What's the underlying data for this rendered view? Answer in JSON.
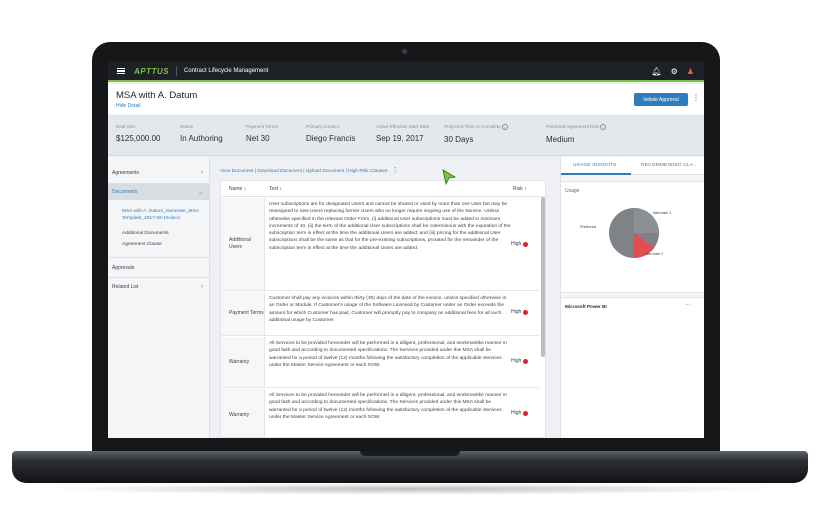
{
  "app": {
    "brand": "APTTUS",
    "title": "Contract Lifecycle Management"
  },
  "header": {
    "document_title": "MSA with A. Datum",
    "hide_detail": "Hide Detail",
    "initiate_button": "Initiate Approval"
  },
  "summary": [
    {
      "label": "Deal Size",
      "value": "$125,000.00"
    },
    {
      "label": "Status",
      "value": "In Authoring"
    },
    {
      "label": "Payment Terms",
      "value": "Net 30"
    },
    {
      "label": "Primary Contact",
      "value": "Diego Francis"
    },
    {
      "label": "Active Effective Start Date",
      "value": "Sep 19, 2017"
    },
    {
      "label": "Projected Time to Complete",
      "value": "30 Days"
    },
    {
      "label": "Predicted Agreement Risk",
      "value": "Medium"
    }
  ],
  "nav": {
    "agreements": "Agreements",
    "documents": "Documents",
    "doc_file": "MSA with A. Datum_Generate_MSA Template_2017-09-19.docx",
    "additional_documents": "Additional Documents",
    "agreement_clause": "Agreement Clause",
    "approvals": "Approvals",
    "related_list": "Related List"
  },
  "doc_links": "View Document | Download Document | Upload Document | High Risk Clauses",
  "table": {
    "headers": {
      "name": "Name ↕",
      "text": "Text ↕",
      "risk": "Risk ↕"
    },
    "rows": [
      {
        "name": "Additional Users",
        "text": "User subscriptions are for designated Users and cannot be shared or used by more than one User but may be reassigned to new Users replacing former Users who no longer require ongoing use of the Service. Unless otherwise specified in the relevant Order Form, (i) additional User subscriptions must be added in minimum increments of 10, (ii) the term of the additional User subscriptions shall be coterminous with the expiration of the subscription term in effect at the time the additional Users are added; and (iii) pricing for the additional User subscriptions shall be the same as that for the pre-existing subscriptions, prorated for the remainder of the subscription term in effect at the time the additional Users are added.",
        "risk": "High"
      },
      {
        "name": "Payment Terms",
        "text": "Customer shall pay any invoices within thirty (30) days of the date of the invoice, unless specified otherwise in an Order or Module. If Customer's usage of the Software Licensed by Customer under an Order exceeds the amount for which Customer has paid, Customer will promptly pay to company an additional fees for all such additional usage by Customer.",
        "risk": "High"
      },
      {
        "name": "Warranty",
        "text": "All Services to be provided hereunder will be performed in a diligent, professional, and workmanlike manner in good faith and according to documented specifications. The Services provided under this MSA shall be warranted for a period of twelve (12) months following the satisfactory completion of the applicable Services under the Master Service Agreement or each SOW.",
        "risk": "High"
      },
      {
        "name": "Warranty",
        "text": "All Services to be provided hereunder will be performed in a diligent, professional, and workmanlike manner in good faith and according to documented specifications. The Services provided under this MSA shall be warranted for a period of twelve (12) months following the satisfactory completion of the applicable Services under the Master Service Agreement or each SOW.",
        "risk": "High"
      }
    ]
  },
  "right_panel": {
    "tab_usage": "USAGE INSIGHTS",
    "tab_recommended": "RECOMMENDED CLA...",
    "usage_title": "Usage",
    "pie_labels": {
      "a1": "Alternate 1",
      "preferred": "Preferred",
      "a2": "Alternate 2"
    },
    "pbi_title": "Microsoft Power BI",
    "pbi_more": "..."
  },
  "colors": {
    "accent": "#2f7dbd",
    "brand_green": "#7cc242",
    "risk_high": "#e0202f",
    "pie_gray": "#7f8286",
    "pie_red": "#e04e4e"
  }
}
